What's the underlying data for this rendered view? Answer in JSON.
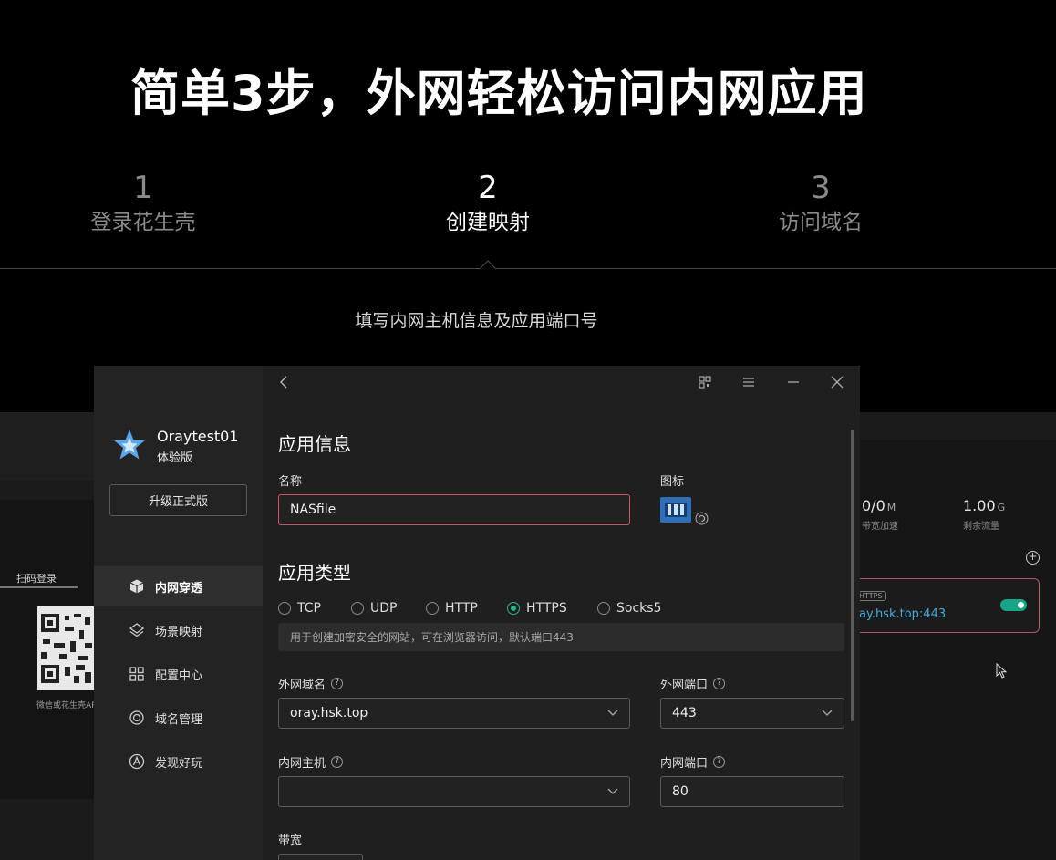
{
  "hero": {
    "title": "简单3步，外网轻松访问内网应用"
  },
  "steps": [
    {
      "num": "1",
      "label": "登录花生壳"
    },
    {
      "num": "2",
      "label": "创建映射"
    },
    {
      "num": "3",
      "label": "访问域名"
    }
  ],
  "subtitle": "填写内网主机信息及应用端口号",
  "background": {
    "qr_label": "扫码登录",
    "qr_caption": "微信或花生壳APP扫码",
    "stats": [
      {
        "value": "0/0",
        "unit": "M",
        "label": "带宽加速"
      },
      {
        "value": "1.00",
        "unit": "G",
        "label": "剩余流量"
      }
    ],
    "mapping": {
      "badge": "HTTPS",
      "domain": "ay.hsk.top:443"
    }
  },
  "sidebar": {
    "username": "Oraytest01",
    "edition": "体验版",
    "upgrade_label": "升级正式版",
    "items": [
      {
        "label": "内网穿透",
        "icon": "cube-icon"
      },
      {
        "label": "场景映射",
        "icon": "layers-icon"
      },
      {
        "label": "配置中心",
        "icon": "grid-icon"
      },
      {
        "label": "域名管理",
        "icon": "target-icon"
      },
      {
        "label": "发现好玩",
        "icon": "discover-icon"
      }
    ]
  },
  "form": {
    "section_app_info": "应用信息",
    "name_label": "名称",
    "name_value": "NASfile",
    "icon_label": "图标",
    "section_app_type": "应用类型",
    "types": [
      "TCP",
      "UDP",
      "HTTP",
      "HTTPS",
      "Socks5"
    ],
    "selected_type": "HTTPS",
    "type_hint": "用于创建加密安全的网站，可在浏览器访问，默认端口443",
    "ext_domain_label": "外网域名",
    "ext_domain_value": "oray.hsk.top",
    "ext_port_label": "外网端口",
    "ext_port_value": "443",
    "int_host_label": "内网主机",
    "int_host_value": "",
    "int_port_label": "内网端口",
    "int_port_value": "80",
    "bandwidth_label": "带宽"
  },
  "colors": {
    "accent": "#2ab392",
    "focus": "#c9546c",
    "link": "#4aa8d8"
  }
}
